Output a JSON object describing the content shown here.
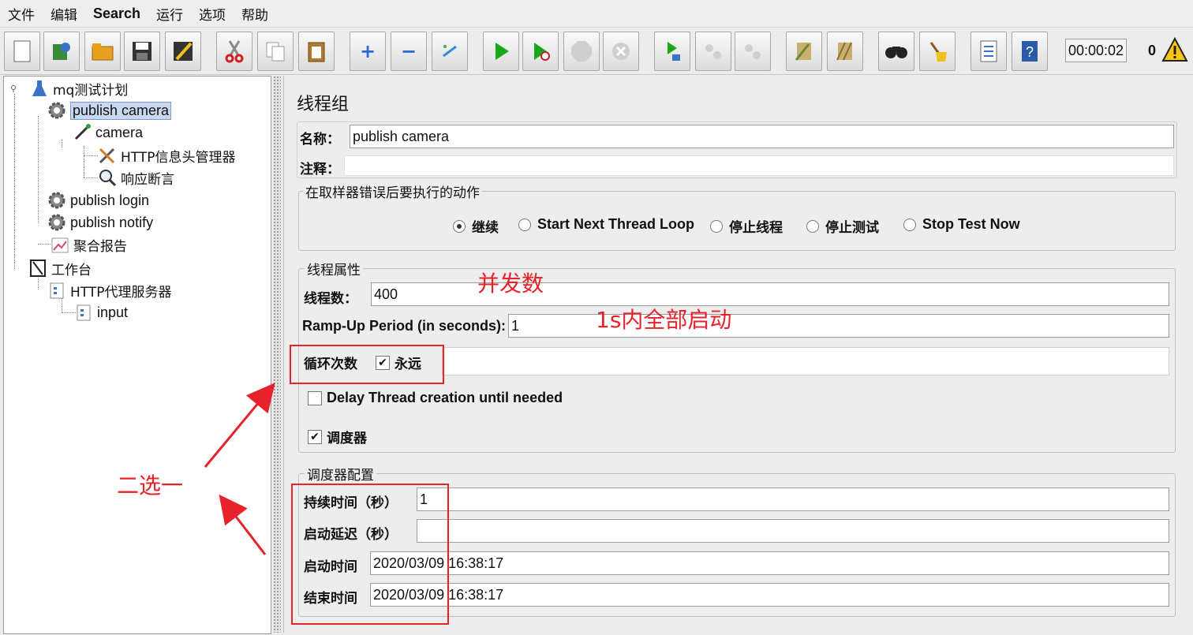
{
  "menu": [
    "文件",
    "编辑",
    "Search",
    "运行",
    "选项",
    "帮助"
  ],
  "toolbar": {
    "icons": [
      "new-icon",
      "templates-icon",
      "open-icon",
      "save-icon",
      "save-as-icon",
      "cut-icon",
      "copy-icon",
      "paste-icon",
      "expand-icon",
      "collapse-icon",
      "toggle-icon",
      "start-icon",
      "start-no-pause-icon",
      "stop-icon",
      "shutdown-icon",
      "remote-start-icon",
      "remote-stop-icon",
      "remote-exit-icon",
      "clear-icon",
      "clear-all-icon",
      "search-icon",
      "reset-search-icon",
      "function-helper-icon",
      "help-icon"
    ],
    "timer": "00:00:02",
    "count": "0"
  },
  "tree": {
    "plan": "mq测试计划",
    "tg1": "publish camera",
    "sampler": "camera",
    "header_mgr": "HTTP信息头管理器",
    "assertion": "响应断言",
    "tg2": "publish login",
    "tg3": "publish notify",
    "report": "聚合报告",
    "workbench": "工作台",
    "proxy": "HTTP代理服务器",
    "input": "input"
  },
  "panel": {
    "title": "线程组",
    "name_label": "名称：",
    "name_value": "publish camera",
    "comment_label": "注释：",
    "comment_value": "",
    "error_group_title": "在取样器错误后要执行的动作",
    "error_options": [
      "继续",
      "Start Next Thread Loop",
      "停止线程",
      "停止测试",
      "Stop Test Now"
    ],
    "error_selected": "继续",
    "thread_group_title": "线程属性",
    "threads_label": "线程数：",
    "threads_value": "400",
    "rampup_label": "Ramp-Up Period (in seconds):",
    "rampup_value": "1",
    "loop_label": "循环次数",
    "forever_label": "永远",
    "forever_checked": true,
    "delay_label": "Delay Thread creation until needed",
    "delay_checked": false,
    "scheduler_label": "调度器",
    "scheduler_checked": true,
    "sched_group_title": "调度器配置",
    "duration_label": "持续时间（秒）",
    "duration_value": "1",
    "startup_delay_label": "启动延迟（秒）",
    "startup_delay_value": "",
    "start_time_label": "启动时间",
    "start_time_value": "2020/03/09 16:38:17",
    "end_time_label": "结束时间",
    "end_time_value": "2020/03/09 16:38:17"
  },
  "annotations": {
    "concurrency": "并发数",
    "rampup_note": "1s内全部启动",
    "choose_one": "二选一",
    "color": "#e8222a"
  }
}
